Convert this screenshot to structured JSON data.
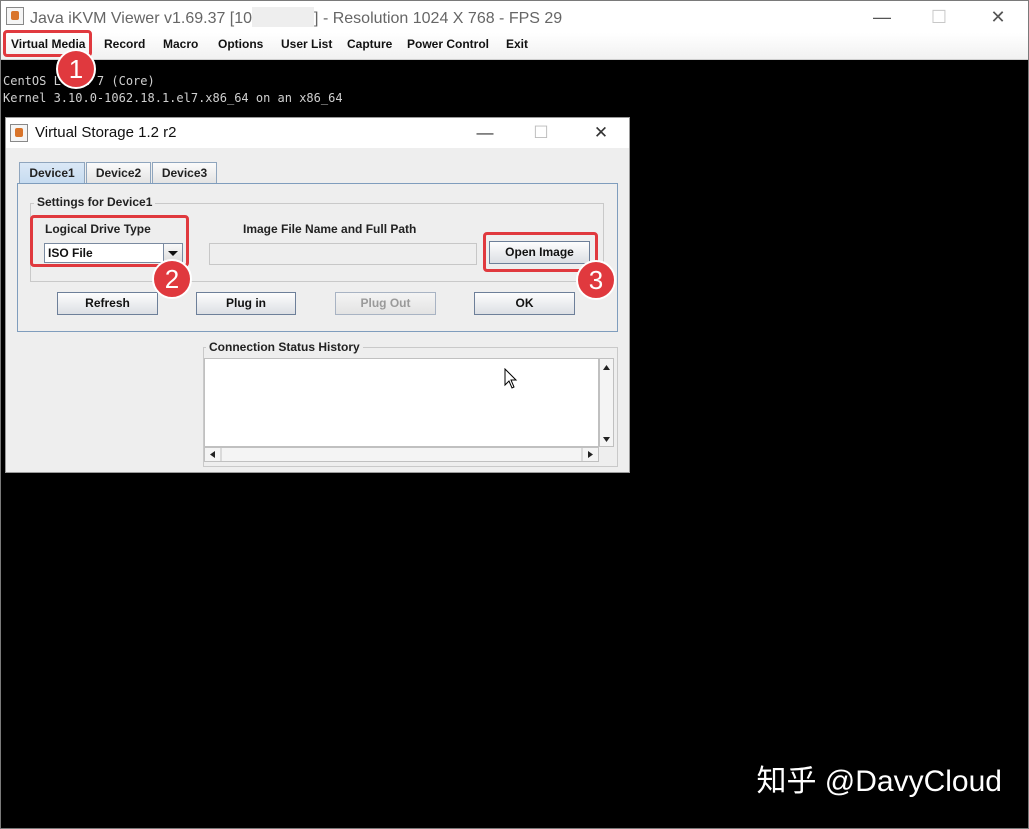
{
  "window": {
    "title_prefix": "Java iKVM Viewer v1.69.37 [10",
    "title_suffix": "]  - Resolution 1024 X 768 - FPS 29",
    "minimize": "—",
    "maximize": "☐",
    "close": "✕"
  },
  "menu": [
    {
      "label": "Virtual Media"
    },
    {
      "label": "Record"
    },
    {
      "label": "Macro"
    },
    {
      "label": "Options"
    },
    {
      "label": "User List"
    },
    {
      "label": "Capture"
    },
    {
      "label": "Power Control"
    },
    {
      "label": "Exit"
    }
  ],
  "terminal": {
    "lines": [
      "CentOS L   x 7 (Core)",
      "Kernel 3.10.0-1062.18.1.el7.x86_64 on an x86_64"
    ]
  },
  "dialog": {
    "title": "Virtual Storage 1.2 r2",
    "minimize": "—",
    "maximize": "☐",
    "close": "✕",
    "tabs": [
      {
        "label": "Device1"
      },
      {
        "label": "Device2"
      },
      {
        "label": "Device3"
      }
    ],
    "settings_caption": "Settings for Device1",
    "drive_type_label": "Logical Drive Type",
    "drive_type_value": "ISO File",
    "image_path_label": "Image File Name and Full Path",
    "image_path_value": "",
    "open_image_button": "Open Image",
    "buttons": {
      "refresh": "Refresh",
      "plug_in": "Plug in",
      "plug_out": "Plug Out",
      "ok": "OK"
    },
    "history_caption": "Connection Status History"
  },
  "annotations": {
    "step1": "1",
    "step2": "2",
    "step3": "3"
  },
  "watermark": "知乎 @DavyCloud",
  "colors": {
    "annotation_red": "#e0393e",
    "tab_active": "#c6dbf0"
  }
}
